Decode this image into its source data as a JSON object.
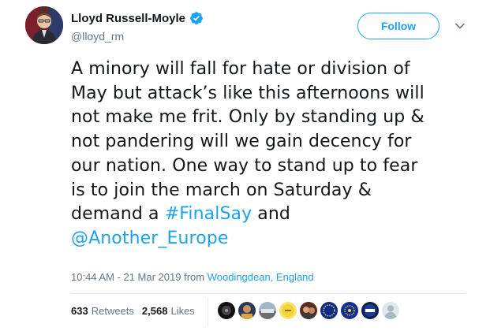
{
  "author": {
    "name": "Lloyd Russell-Moyle",
    "handle": "@lloyd_rm",
    "verified": true
  },
  "follow_button": {
    "label": "Follow"
  },
  "tweet": {
    "lines": [
      "A minory will fall for hate or division of",
      "May but attack’s like this afternoons will",
      "not make me frit. Only by standing up &",
      "not pandering will we gain decency for",
      "our nation. One way to stand up to fear",
      "is to join the march on Saturday &",
      "demand a"
    ],
    "hashtag": "#FinalSay",
    "and_text": " and",
    "mention": "@Another_Europe"
  },
  "meta": {
    "timestamp": "10:44 AM - 21 Mar 2019 from ",
    "location": "Woodingdean, England"
  },
  "stats": {
    "retweets_count": "633",
    "retweets_label": "Retweets",
    "likes_count": "2,568",
    "likes_label": "Likes"
  },
  "colors": {
    "accent": "#1da1f2",
    "text": "#14171a",
    "muted": "#657786",
    "divider": "#e6ecf0"
  },
  "icons": {
    "verified": "verified-badge-icon",
    "more": "chevron-down-icon"
  }
}
